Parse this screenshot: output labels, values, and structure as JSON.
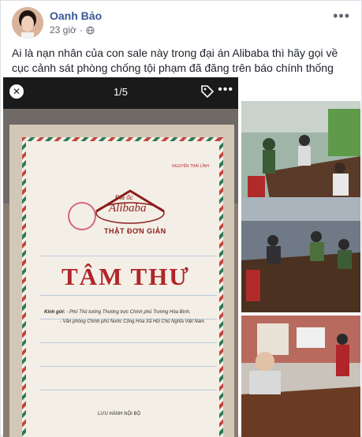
{
  "post": {
    "author": "Oanh Bảo",
    "time": "23 giờ",
    "text": "Ai là nạn nhân của con sale này trong đại án Alibaba thì hãy gọi về cục cảnh sát phòng chống tội phạm đã đăng trên báo chính thống"
  },
  "viewer": {
    "counter": "1/5",
    "more": "•••"
  },
  "letter": {
    "corner_text": "NGUYỄN THÁI LỈNH",
    "logo_top": "Địa ốc",
    "logo_name": "Alibaba",
    "logo_slogan": "THẬT ĐƠN GIẢN",
    "title": "TÂM THƯ",
    "addressee_label": "Kính gửi:",
    "addressee_1": "- Phó Thủ tướng Thường trực Chính phủ Trương Hòa Bình.",
    "addressee_2": "- Văn phòng Chính phủ Nước Cộng Hòa Xã Hội Chủ Nghĩa Việt Nam",
    "footer": "LƯU HÀNH NỘI BỘ"
  },
  "icons": {
    "more": "more-icon",
    "globe": "globe-icon",
    "close": "close-icon",
    "tag": "tag-icon"
  },
  "colors": {
    "author_link": "#385898",
    "letter_title": "#b0252a"
  }
}
